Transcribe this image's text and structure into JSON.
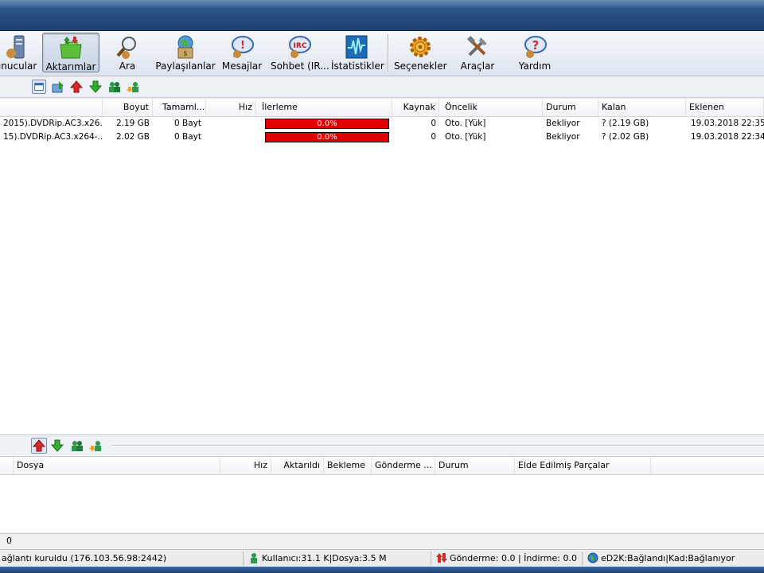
{
  "toolbar": {
    "buttons": [
      {
        "label": "unucular",
        "icon": "servers-icon"
      },
      {
        "label": "Aktarımlar",
        "icon": "transfers-icon",
        "active": true
      },
      {
        "label": "Ara",
        "icon": "search-icon"
      },
      {
        "label": "Paylaşılanlar",
        "icon": "shared-files-icon"
      },
      {
        "label": "Mesajlar",
        "icon": "messages-icon"
      },
      {
        "label": "Sohbet (IR...",
        "icon": "irc-icon"
      },
      {
        "label": "İstatistikler",
        "icon": "statistics-icon"
      },
      {
        "label": "Seçenekler",
        "icon": "gear-icon"
      },
      {
        "label": "Araçlar",
        "icon": "tools-icon"
      },
      {
        "label": "Yardım",
        "icon": "help-icon"
      }
    ]
  },
  "downloads": {
    "columns": {
      "boyut": "Boyut",
      "tamam": "Tamaml...",
      "hiz": "Hız",
      "ilerleme": "İlerleme",
      "kaynak": "Kaynak",
      "oncelik": "Öncelik",
      "durum": "Durum",
      "kalan": "Kalan",
      "eklenen": "Eklenen"
    },
    "rows": [
      {
        "name": "2015).DVDRip.AC3.x26...",
        "size": "2.19 GB",
        "completed": "0 Bayt",
        "speed": "",
        "progress_text": "0.0%",
        "progress": 0.0,
        "sources": "0",
        "priority": "Oto. [Yük]",
        "status": "Bekliyor",
        "remaining": "? (2.19 GB)",
        "added": "19.03.2018 22:35:"
      },
      {
        "name": "15).DVDRip.AC3.x264-...",
        "size": "2.02 GB",
        "completed": "0 Bayt",
        "speed": "",
        "progress_text": "0.0%",
        "progress": 0.0,
        "sources": "0",
        "priority": "Oto. [Yük]",
        "status": "Bekliyor",
        "remaining": "? (2.02 GB)",
        "added": "19.03.2018 22:34:0"
      }
    ]
  },
  "uploads": {
    "columns": {
      "dosya": "Dosya",
      "hiz": "Hız",
      "aktarildi": "Aktarıldı",
      "bekleme": "Bekleme",
      "gonderme": "Gönderme ...",
      "durum": "Durum",
      "parcalar": "Elde Edilmiş Parçalar"
    },
    "count": "0"
  },
  "statusbar": {
    "connection": "ağlantı kuruldu (176.103.56.98:2442)",
    "users": "Kullanıcı:31.1 K|Dosya:3.5 M",
    "traffic": "Gönderme: 0.0 | İndirme: 0.0",
    "network": "eD2K:Bağlandı|Kad:Bağlanıyor"
  },
  "colors": {
    "progress": "#e00000",
    "titlebar": "#24497a"
  }
}
